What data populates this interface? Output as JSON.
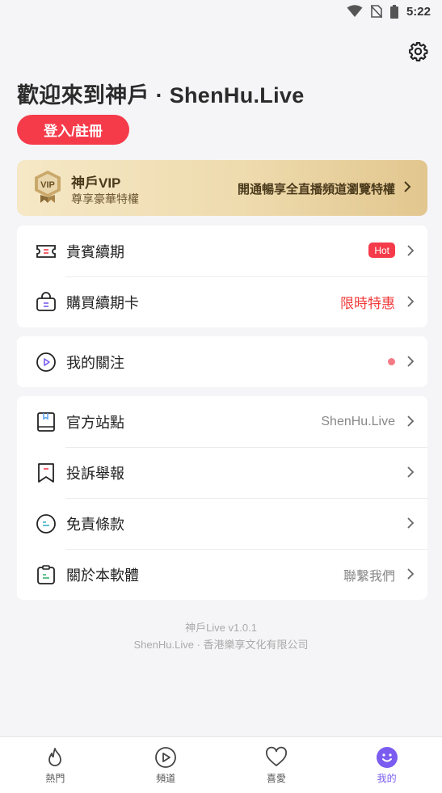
{
  "status_bar": {
    "time": "5:22"
  },
  "header": {
    "welcome": "歡迎來到神戶 · ShenHu.Live",
    "login_label": "登入/註冊"
  },
  "vip": {
    "title": "神戶VIP",
    "subtitle": "尊享豪華特權",
    "promo": "開通暢享全直播頻道瀏覽特權",
    "badge_text": "VIP"
  },
  "menu_group1": [
    {
      "label": "貴賓續期",
      "badge": "Hot"
    },
    {
      "label": "購買續期卡",
      "right_text": "限時特惠"
    }
  ],
  "menu_group2": [
    {
      "label": "我的關注"
    }
  ],
  "menu_group3": [
    {
      "label": "官方站點",
      "right_text": "ShenHu.Live"
    },
    {
      "label": "投訴舉報"
    },
    {
      "label": "免責條款"
    },
    {
      "label": "關於本軟體",
      "right_text": "聯繫我們"
    }
  ],
  "footer": {
    "version": "神戶Live v1.0.1",
    "company": "ShenHu.Live · 香港樂享文化有限公司"
  },
  "tabs": [
    {
      "label": "熱門",
      "icon": "flame-icon"
    },
    {
      "label": "頻道",
      "icon": "play-circle-icon"
    },
    {
      "label": "喜愛",
      "icon": "heart-icon"
    },
    {
      "label": "我的",
      "icon": "smile-icon"
    }
  ],
  "colors": {
    "accent": "#7a5cf0",
    "primary_red": "#f53b4a",
    "vip_gold": "#eedbae"
  }
}
